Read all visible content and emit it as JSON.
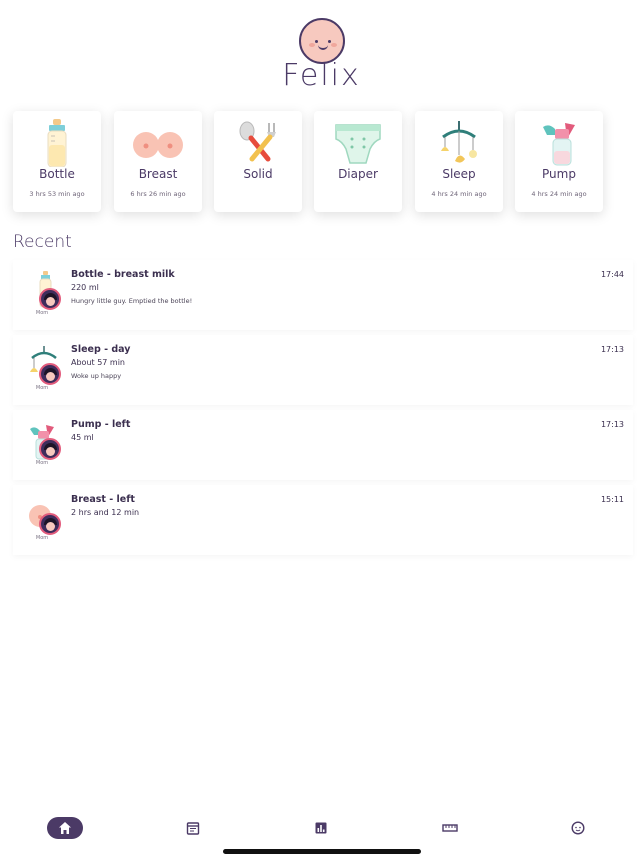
{
  "header": {
    "name": "Felix",
    "avatar_icon": "baby-face-icon"
  },
  "quick_actions": [
    {
      "label": "Bottle",
      "since": "3 hrs 53 min ago",
      "icon": "bottle-icon"
    },
    {
      "label": "Breast",
      "since": "6 hrs 26 min ago",
      "icon": "breast-icon"
    },
    {
      "label": "Solid",
      "since": "",
      "icon": "spoon-fork-icon"
    },
    {
      "label": "Diaper",
      "since": "",
      "icon": "diaper-icon"
    },
    {
      "label": "Sleep",
      "since": "4 hrs 24 min ago",
      "icon": "mobile-icon"
    },
    {
      "label": "Pump",
      "since": "4 hrs 24 min ago",
      "icon": "pump-icon"
    }
  ],
  "recent": {
    "title": "Recent",
    "entries": [
      {
        "title": "Bottle - breast milk",
        "amount": "220 ml",
        "note": "Hungry little guy. Emptied the bottle!",
        "time": "17:44",
        "who": "Mom",
        "icon": "bottle-icon"
      },
      {
        "title": "Sleep - day",
        "amount": "About 57 min",
        "note": "Woke up happy",
        "time": "17:13",
        "who": "Mom",
        "icon": "mobile-icon"
      },
      {
        "title": "Pump - left",
        "amount": "45 ml",
        "note": "",
        "time": "17:13",
        "who": "Mom",
        "icon": "pump-icon"
      },
      {
        "title": "Breast - left",
        "amount": "2 hrs and 12 min",
        "note": "",
        "time": "15:11",
        "who": "Mom",
        "icon": "breast-icon"
      }
    ]
  },
  "tabbar": {
    "tabs": [
      {
        "icon": "home-icon",
        "active": true
      },
      {
        "icon": "calendar-icon",
        "active": false
      },
      {
        "icon": "chart-icon",
        "active": false
      },
      {
        "icon": "ruler-icon",
        "active": false
      },
      {
        "icon": "baby-icon",
        "active": false
      }
    ]
  },
  "colors": {
    "primary": "#4b3a66",
    "accent_pink": "#e25b7c",
    "skin": "#f7c9bf"
  }
}
